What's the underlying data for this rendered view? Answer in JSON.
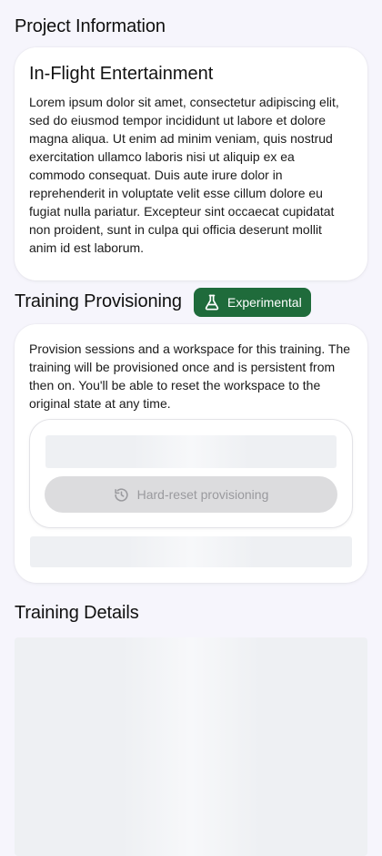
{
  "project_section": {
    "title": "Project Information",
    "card_title": "In-Flight Entertainment",
    "description": "Lorem ipsum dolor sit amet, consectetur adipiscing elit, sed do eiusmod tempor incididunt ut labore et dolore magna aliqua. Ut enim ad minim veniam, quis nostrud exercitation ullamco laboris nisi ut aliquip ex ea commodo consequat. Duis aute irure dolor in reprehenderit in voluptate velit esse cillum dolore eu fugiat nulla pariatur. Excepteur sint occaecat cupidatat non proident, sunt in culpa qui officia deserunt mollit anim id est laborum."
  },
  "provisioning_section": {
    "title": "Training Provisioning",
    "badge_label": "Experimental",
    "badge_icon": "flask-icon",
    "description": "Provision sessions and a workspace for this training. The training will be provisioned once and is persistent from then on. You'll be able to reset the workspace to the original state at any time.",
    "reset_button_label": "Hard-reset provisioning",
    "reset_button_icon": "history-icon",
    "reset_button_disabled": true
  },
  "details_section": {
    "title": "Training Details"
  },
  "colors": {
    "background": "#f6f5fc",
    "badge_green": "#1f6b3b",
    "disabled_button": "#dcdcde",
    "skeleton": "#eef0f3"
  }
}
